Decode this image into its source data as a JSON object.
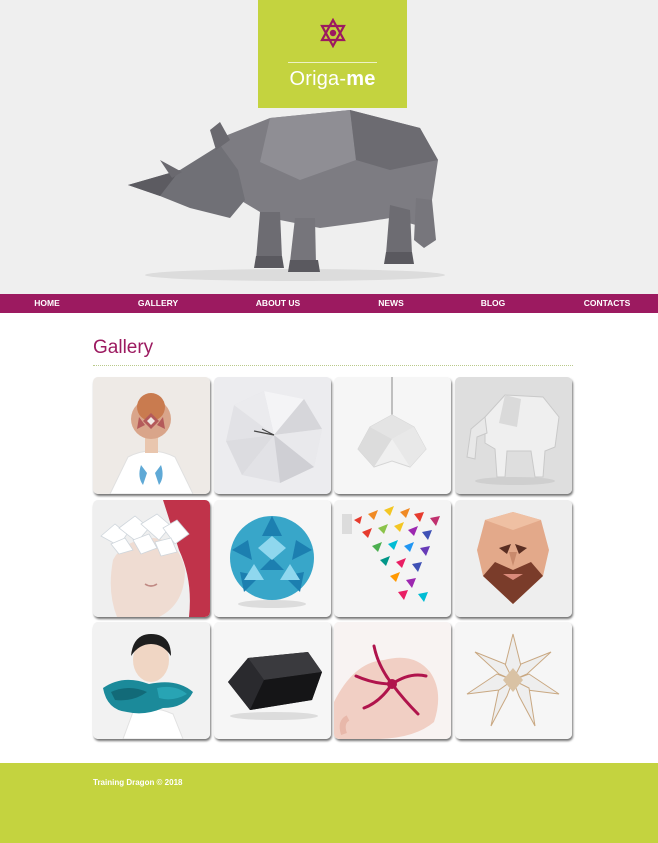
{
  "brand": {
    "name_light": "Origa-",
    "name_bold": "me",
    "accent_color": "#c4d33f",
    "primary_color": "#9c1a60",
    "logo_icon": "origami-star-icon"
  },
  "hero": {
    "image": "origami-rhino-image"
  },
  "nav": {
    "items": [
      {
        "label": "HOME"
      },
      {
        "label": "GALLERY"
      },
      {
        "label": "ABOUT US"
      },
      {
        "label": "NEWS"
      },
      {
        "label": "BLOG"
      },
      {
        "label": "CONTACTS"
      }
    ]
  },
  "gallery": {
    "title": "Gallery",
    "images": [
      "origami-mask-person",
      "origami-clock",
      "origami-lamp",
      "origami-elephant",
      "origami-flower-blindfold",
      "origami-blue-ball",
      "origami-rainbow-fish",
      "origami-face-mask",
      "origami-teal-scarf",
      "origami-black-box",
      "origami-pink-starfish",
      "origami-star"
    ]
  },
  "footer": {
    "copyright": "Training Dragon © 2018"
  }
}
